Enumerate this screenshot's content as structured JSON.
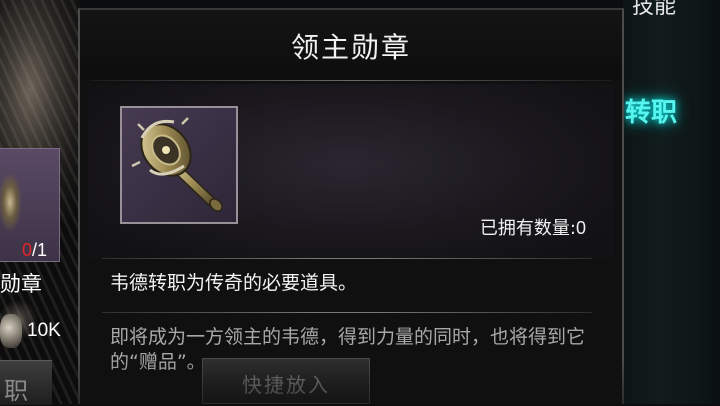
{
  "popup": {
    "title": "领主勋章",
    "owned_label": "已拥有数量:",
    "owned_value": "0",
    "description": "韦德转职为传奇的必要道具。",
    "lore": "即将成为一方领主的韦德，得到力量的同时，也将得到它的“赠品”。",
    "item_icon": "lord-medal-scepter-icon"
  },
  "left_panel": {
    "count_have": "0",
    "count_need": "/1",
    "item_name": "勋章",
    "cost": "10K",
    "button_label": "职"
  },
  "right_panel": {
    "top_text": "技能",
    "job_label": "转职"
  },
  "bottom": {
    "quick_place_label": "快捷放入"
  },
  "colors": {
    "accent_cyan": "#57f5ef",
    "count_red": "#e0262a",
    "item_frame_purple": "#3a3045"
  }
}
